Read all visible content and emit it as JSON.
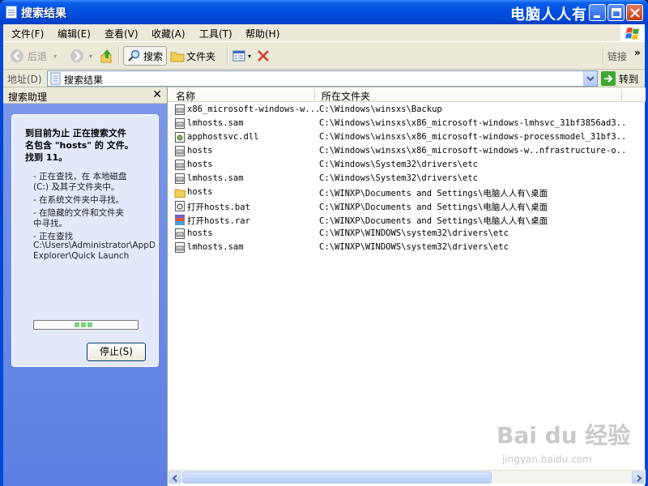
{
  "window": {
    "title": "搜索结果",
    "watermark": "电脑人人有"
  },
  "menu": [
    "文件(F)",
    "编辑(E)",
    "查看(V)",
    "收藏(A)",
    "工具(T)",
    "帮助(H)"
  ],
  "toolbar": {
    "back": "后退",
    "search": "搜索",
    "folders": "文件夹",
    "links": "链接",
    "chevron": "»"
  },
  "address": {
    "label": "地址(D)",
    "value": "搜索结果",
    "go": "转到"
  },
  "assistant": {
    "title": "搜索助理",
    "status_lines": [
      "到目前为止 正在搜索文件",
      "名包含 \"hosts\" 的 文件。",
      "找到 11。"
    ],
    "steps": [
      [
        "- 正在查找，在 本地磁盘",
        "(C:) 及其子文件夹中。"
      ],
      [
        "- 在系统文件夹中寻找。"
      ],
      [
        "- 在隐藏的文件和文件夹",
        "中寻找。"
      ],
      [
        "- 正在查找",
        "C:\\Users\\Administrator\\AppD",
        "Explorer\\Quick Launch"
      ]
    ],
    "stop_label": "停止(S)"
  },
  "list": {
    "columns": [
      "名称",
      "所在文件夹"
    ],
    "rows": [
      {
        "name": "x86_microsoft-windows-w...",
        "path": "C:\\Windows\\winsxs\\Backup",
        "icon": "sys-file-icon"
      },
      {
        "name": "lmhosts.sam",
        "path": "C:\\Windows\\winsxs\\x86_microsoft-windows-lmhsvc_31bf3856ad3...",
        "icon": "sys-file-icon"
      },
      {
        "name": "apphostsvc.dll",
        "path": "C:\\Windows\\winsxs\\x86_microsoft-windows-processmodel_31bf3...",
        "icon": "dll-icon"
      },
      {
        "name": "hosts",
        "path": "C:\\Windows\\winsxs\\x86_microsoft-windows-w..nfrastructure-o...",
        "icon": "sys-file-icon"
      },
      {
        "name": "hosts",
        "path": "C:\\Windows\\System32\\drivers\\etc",
        "icon": "sys-file-icon"
      },
      {
        "name": "lmhosts.sam",
        "path": "C:\\Windows\\System32\\drivers\\etc",
        "icon": "sys-file-icon"
      },
      {
        "name": "hosts",
        "path": "C:\\WINXP\\Documents and Settings\\电脑人人有\\桌面",
        "icon": "folder-icon"
      },
      {
        "name": "打开hosts.bat",
        "path": "C:\\WINXP\\Documents and Settings\\电脑人人有\\桌面",
        "icon": "bat-icon"
      },
      {
        "name": "打开hosts.rar",
        "path": "C:\\WINXP\\Documents and Settings\\电脑人人有\\桌面",
        "icon": "rar-icon"
      },
      {
        "name": "hosts",
        "path": "C:\\WINXP\\WINDOWS\\system32\\drivers\\etc",
        "icon": "sys-file-icon"
      },
      {
        "name": "lmhosts.sam",
        "path": "C:\\WINXP\\WINDOWS\\system32\\drivers\\etc",
        "icon": "sys-file-icon"
      }
    ]
  },
  "watermark_bottom": {
    "brand": "Bai du 经验",
    "url": "jingyan.baidu.com"
  }
}
